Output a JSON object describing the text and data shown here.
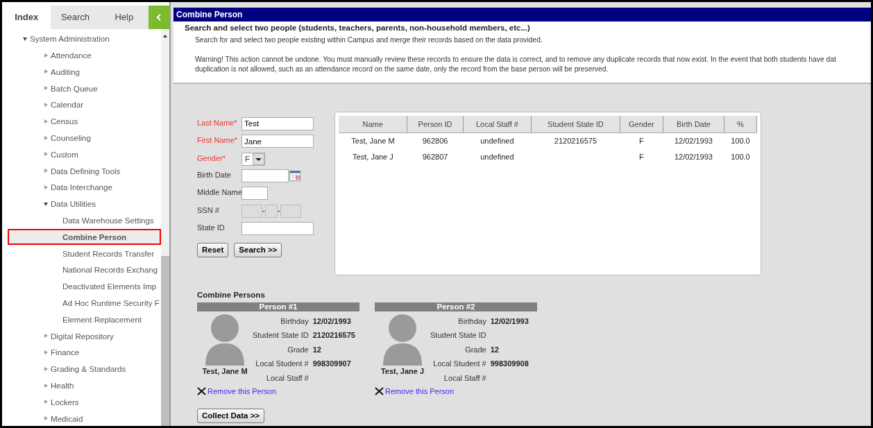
{
  "sidebar": {
    "tabs": [
      {
        "label": "Index",
        "selected": true
      },
      {
        "label": "Search",
        "selected": false
      },
      {
        "label": "Help",
        "selected": false
      }
    ],
    "tree": [
      {
        "label": "System Administration",
        "expanded": true,
        "selected": false,
        "children": [
          {
            "label": "Attendance",
            "expanded": false,
            "selected": false
          },
          {
            "label": "Auditing",
            "expanded": false,
            "selected": false
          },
          {
            "label": "Batch Queue",
            "expanded": false,
            "selected": false
          },
          {
            "label": "Calendar",
            "expanded": false,
            "selected": false
          },
          {
            "label": "Census",
            "expanded": false,
            "selected": false
          },
          {
            "label": "Counseling",
            "expanded": false,
            "selected": false
          },
          {
            "label": "Custom",
            "expanded": false,
            "selected": false
          },
          {
            "label": "Data Defining Tools",
            "expanded": false,
            "selected": false
          },
          {
            "label": "Data Interchange",
            "expanded": false,
            "selected": false
          },
          {
            "label": "Data Utilities",
            "expanded": true,
            "selected": false,
            "children": [
              {
                "label": "Data Warehouse Settings",
                "selected": false
              },
              {
                "label": "Combine Person",
                "selected": true
              },
              {
                "label": "Student Records Transfer",
                "selected": false
              },
              {
                "label": "National Records Exchang",
                "selected": false
              },
              {
                "label": "Deactivated Elements Imp",
                "selected": false
              },
              {
                "label": "Ad Hoc Runtime Security F",
                "selected": false
              },
              {
                "label": "Element Replacement",
                "selected": false
              }
            ]
          },
          {
            "label": "Digital Repository",
            "expanded": false,
            "selected": false
          },
          {
            "label": "Finance",
            "expanded": false,
            "selected": false
          },
          {
            "label": "Grading & Standards",
            "expanded": false,
            "selected": false
          },
          {
            "label": "Health",
            "expanded": false,
            "selected": false
          },
          {
            "label": "Lockers",
            "expanded": false,
            "selected": false
          },
          {
            "label": "Medicaid",
            "expanded": false,
            "selected": false
          }
        ]
      }
    ]
  },
  "main": {
    "title": "Combine Person",
    "heading": "Search and select two people (students, teachers, parents, non-household members, etc...)",
    "description": "Search for and select two people existing within Campus and merge their records based on the data provided.",
    "warning_lines": [
      "Warning! This action cannot be undone. You must manually review these records to ensure the data is correct, and to remove any duplicate records that now exist. In the event that both students have dat",
      "duplication is not allowed, such as an attendance record on the same date, only the record from the base person will be preserved."
    ]
  },
  "search_form": {
    "fields": [
      {
        "label": "Last Name*",
        "required": true,
        "kind": "text",
        "value": "Test"
      },
      {
        "label": "First Name*",
        "required": true,
        "kind": "text",
        "value": "Jane"
      },
      {
        "label": "Gender*",
        "required": true,
        "kind": "select",
        "value": "F"
      },
      {
        "label": "Birth Date",
        "required": false,
        "kind": "date"
      },
      {
        "label": "Middle Name",
        "required": false,
        "kind": "short"
      },
      {
        "label": "SSN #",
        "required": false,
        "kind": "ssn",
        "disabled": true,
        "separators": [
          "-",
          "-"
        ]
      },
      {
        "label": "State ID",
        "required": false,
        "kind": "text"
      }
    ],
    "buttons": [
      "Reset",
      "Search >>"
    ]
  },
  "results": {
    "columns": [
      "Name",
      "Person ID",
      "Local Staff #",
      "Student State ID",
      "Gender",
      "Birth Date",
      "%"
    ],
    "rows": [
      [
        "Test, Jane M",
        "962806",
        "undefined",
        "2120216575",
        "F",
        "12/02/1993",
        "100.0"
      ],
      [
        "Test, Jane J",
        "962807",
        "undefined",
        "",
        "F",
        "12/02/1993",
        "100.0"
      ]
    ]
  },
  "combine": {
    "title": "Combine Persons",
    "persons": [
      {
        "header": "Person #1",
        "name": "Test, Jane M",
        "fields": [
          {
            "label": "Birthday",
            "value": "12/02/1993"
          },
          {
            "label": "Student State ID",
            "value": "2120216575"
          },
          {
            "label": "Grade",
            "value": "12"
          },
          {
            "label": "Local Student #",
            "value": "998309907"
          },
          {
            "label": "Local Staff #"
          }
        ],
        "remove_link": "Remove this Person"
      },
      {
        "header": "Person #2",
        "name": "Test, Jane J",
        "fields": [
          {
            "label": "Birthday",
            "value": "12/02/1993"
          },
          {
            "label": "Student State ID"
          },
          {
            "label": "Grade",
            "value": "12"
          },
          {
            "label": "Local Student #",
            "value": "998309908"
          },
          {
            "label": "Local Staff #"
          }
        ],
        "remove_link": "Remove this Person"
      }
    ],
    "button": "Collect Data >>"
  }
}
